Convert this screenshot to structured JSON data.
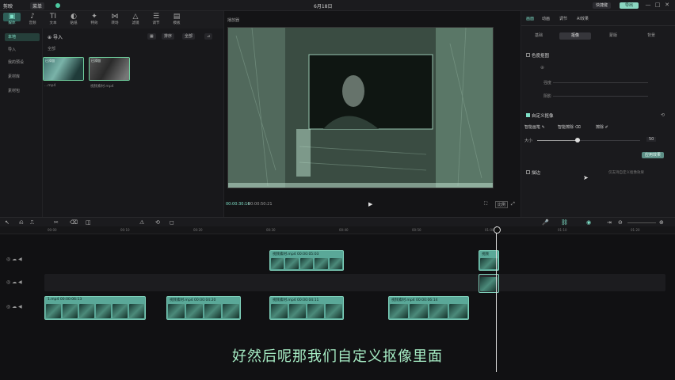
{
  "app": {
    "logo": "剪映",
    "menu": "菜单",
    "title": "6月18日",
    "right_buttons": [
      "快捷键",
      "导出"
    ],
    "window_controls": [
      "—",
      "□",
      "✕"
    ]
  },
  "toolbar": {
    "tabs": [
      {
        "icon": "▣",
        "label": "媒体"
      },
      {
        "icon": "♪",
        "label": "音频"
      },
      {
        "icon": "TI",
        "label": "文本"
      },
      {
        "icon": "◐",
        "label": "贴纸"
      },
      {
        "icon": "✦",
        "label": "特效"
      },
      {
        "icon": "⋈",
        "label": "转场"
      },
      {
        "icon": "△",
        "label": "滤镜"
      },
      {
        "icon": "☰",
        "label": "调节"
      },
      {
        "icon": "▤",
        "label": "模板"
      }
    ]
  },
  "leftnav": {
    "items": [
      "本地",
      "导入",
      "我的预设",
      "素材库",
      "素材包"
    ]
  },
  "media": {
    "import_label": "导入",
    "section": "全部",
    "tools": [
      "排序",
      "全部"
    ],
    "thumbs": [
      {
        "tag": "已添加",
        "name": "...mp4"
      },
      {
        "tag": "已添加",
        "name": "视频素材.mp4"
      }
    ]
  },
  "player": {
    "title": "播放器",
    "current_time": "00:00:30:16",
    "total_time": "00:00:50:21",
    "controls": {
      "play": "▶",
      "fit": "⛶",
      "ratio": "比例",
      "fullscreen": "⤢"
    }
  },
  "rpanel": {
    "tabs": [
      "画面",
      "动画",
      "调节",
      "AI效果"
    ],
    "subtabs": [
      "基础",
      "抠像",
      "蒙版",
      "背景"
    ],
    "chroma_section": "色度抠图",
    "chroma_params": [
      "强度",
      "阴影"
    ],
    "custom_section": "自定义抠像",
    "custom_tools": [
      "智能画笔",
      "智能擦除",
      "擦除"
    ],
    "size_label": "大小",
    "size_value": 50,
    "apply_label": "应用效果",
    "edge_section": "描边",
    "edge_hint": "仅支持自定义抠像效果"
  },
  "timeline": {
    "tool_icons": [
      "↖",
      "⎌",
      "⎍",
      "✂",
      "⌫",
      "◫",
      "⚠",
      "⟲",
      "◻"
    ],
    "right_icons": [
      "🎤",
      "⛓",
      "◉",
      "⇥",
      "⊖",
      "⊕"
    ],
    "ticks": [
      "00:00",
      "00:10",
      "00:20",
      "00:30",
      "00:40",
      "00:50",
      "01:00",
      "01:10",
      "01:20"
    ],
    "clips_top": [
      {
        "name": "视频素材.mp4 00:00:05:03"
      },
      {
        "name": "视频"
      }
    ],
    "clips_main": [
      {
        "name": "1.mp4 00:00:06:13"
      },
      {
        "name": "视频素材.mp4 00:00:04:20"
      },
      {
        "name": "视频素材.mp4 00:00:04:11"
      },
      {
        "name": "视频素材.mp4 00:00:06:14"
      }
    ]
  },
  "subtitle": "好然后呢那我们自定义抠像里面",
  "colors": {
    "accent": "#7fe0c8",
    "clip": "#5aa898",
    "bg": "#141416"
  }
}
